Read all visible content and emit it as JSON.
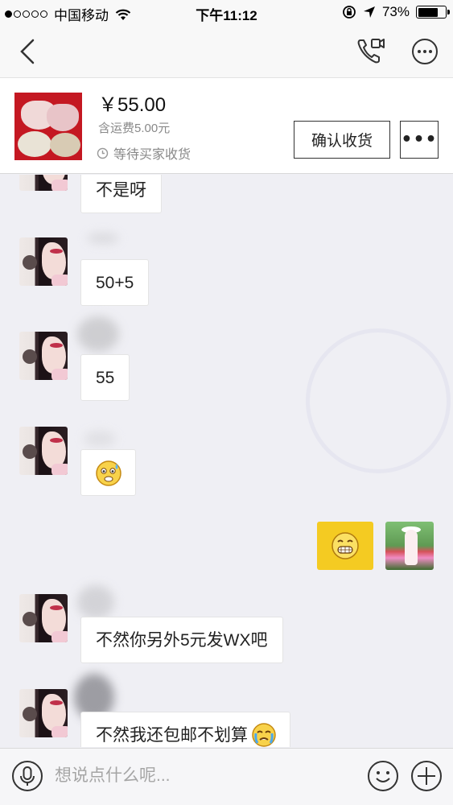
{
  "status_bar": {
    "carrier": "中国移动",
    "time": "下午11:12",
    "battery": "73%",
    "battery_level": 0.73
  },
  "nav": {
    "back_icon": "chevron-left-icon",
    "call_icon": "phone-video-icon",
    "more_icon": "more-circle-icon"
  },
  "product": {
    "price": "￥55.00",
    "shipping": "含运费5.00元",
    "status": "等待买家收货",
    "confirm_label": "确认收货",
    "more_label": "•••"
  },
  "messages": [
    {
      "from": "other",
      "text": "不是呀"
    },
    {
      "from": "other",
      "text": "50+5"
    },
    {
      "from": "other",
      "text": "55"
    },
    {
      "from": "other",
      "type": "emoji",
      "emoji": "sweat-smile-emoji"
    },
    {
      "from": "me",
      "type": "sticker",
      "emoji": "grin-emoji"
    },
    {
      "from": "other",
      "text": "不然你另外5元发WX吧"
    },
    {
      "from": "other",
      "text": "不然我还包邮不划算"
    }
  ],
  "input": {
    "placeholder": "想说点什么呢...",
    "mic_icon": "microphone-icon",
    "emoji_icon": "smiley-icon",
    "plus_icon": "plus-icon"
  }
}
